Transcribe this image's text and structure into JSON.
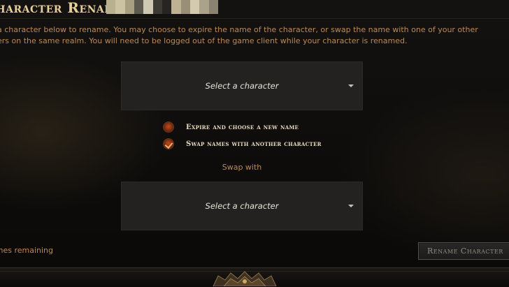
{
  "header": {
    "title": "Character Rename:",
    "name_mosaic_colors": [
      "#b9b08f",
      "#ccc3a3",
      "#a89f82",
      "#5c5a4e",
      "#cfc8b2",
      "#3c3a33",
      "#262522",
      "#bdb394",
      "#998f77",
      "#d3cab0",
      "#aaa28b",
      "#8a8372"
    ]
  },
  "description": {
    "line1": "a character below to rename. You may choose to expire the name of the character, or swap the name with one of your other",
    "line2": "ers on the same realm. You will need to be logged out of the game client while your character is renamed."
  },
  "character_select": {
    "value": "Select a character"
  },
  "options": [
    {
      "label": "Expire and choose a new name",
      "checked": false
    },
    {
      "label": "Swap names with another character",
      "checked": true
    }
  ],
  "swap_with": {
    "label": "Swap with",
    "value": "Select a character"
  },
  "footer": {
    "remaining": "ames remaining",
    "rename_button": "Rename Character"
  }
}
